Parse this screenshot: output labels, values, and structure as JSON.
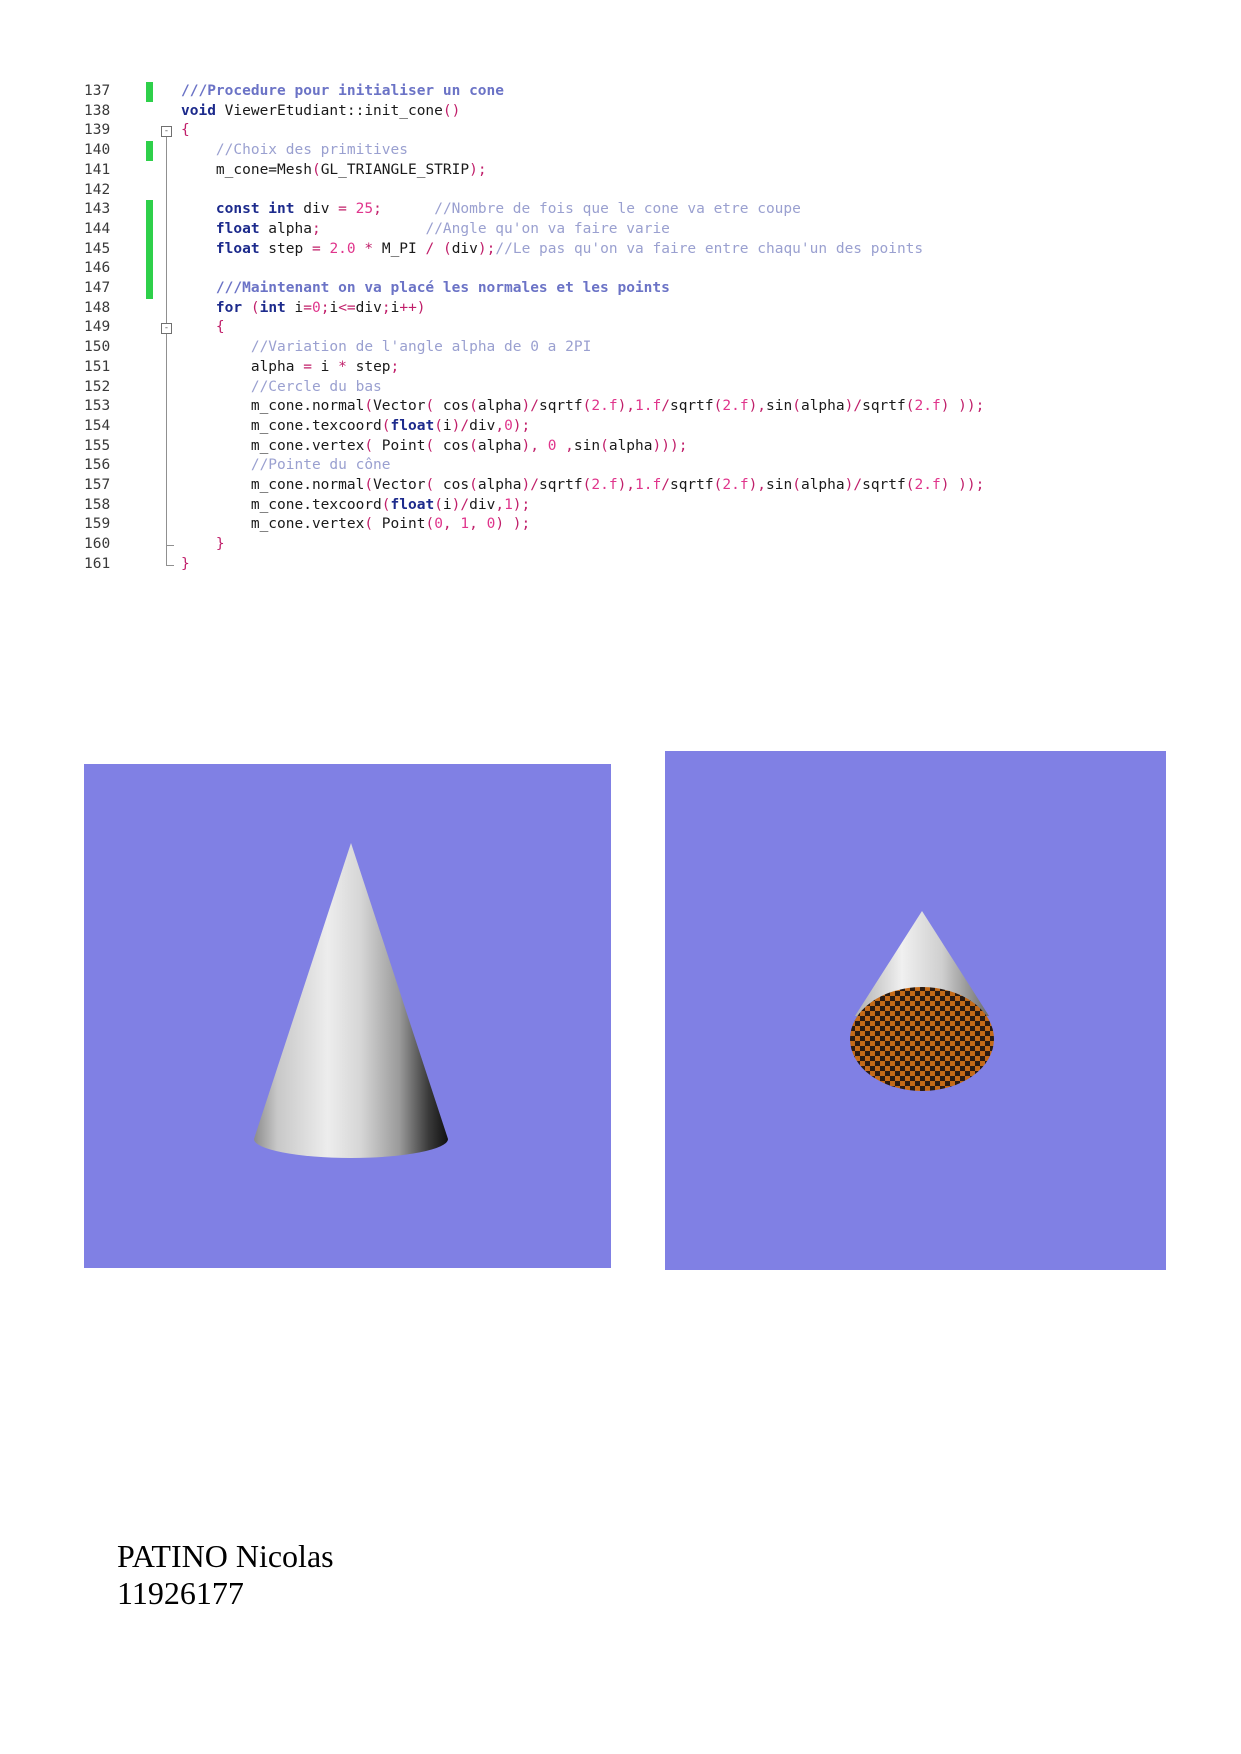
{
  "code": {
    "lines": [
      {
        "n": "137",
        "changed": true,
        "tokens": [
          [
            "dc",
            "///Procedure pour initialiser un cone"
          ]
        ]
      },
      {
        "n": "138",
        "changed": false,
        "tokens": [
          [
            "kw",
            "void"
          ],
          [
            "tx",
            " ViewerEtudiant::init_cone"
          ],
          [
            "op",
            "()"
          ]
        ]
      },
      {
        "n": "139",
        "changed": false,
        "tokens": [
          [
            "op",
            "{"
          ]
        ]
      },
      {
        "n": "140",
        "changed": true,
        "tokens": [
          [
            "tx",
            "    "
          ],
          [
            "cm",
            "//Choix des primitives"
          ]
        ]
      },
      {
        "n": "141",
        "changed": false,
        "tokens": [
          [
            "tx",
            "    m_cone=Mesh"
          ],
          [
            "op",
            "("
          ],
          [
            "tx",
            "GL_TRIANGLE_STRIP"
          ],
          [
            "op",
            ");"
          ]
        ]
      },
      {
        "n": "142",
        "changed": false,
        "tokens": []
      },
      {
        "n": "143",
        "changed": true,
        "tokens": [
          [
            "tx",
            "    "
          ],
          [
            "kw",
            "const int"
          ],
          [
            "tx",
            " div "
          ],
          [
            "op",
            "="
          ],
          [
            "tx",
            " "
          ],
          [
            "nm",
            "25"
          ],
          [
            "op",
            ";"
          ],
          [
            "tx",
            "      "
          ],
          [
            "cm",
            "//Nombre de fois que le cone va etre coupe"
          ]
        ]
      },
      {
        "n": "144",
        "changed": true,
        "tokens": [
          [
            "tx",
            "    "
          ],
          [
            "kw",
            "float"
          ],
          [
            "tx",
            " alpha"
          ],
          [
            "op",
            ";"
          ],
          [
            "tx",
            "            "
          ],
          [
            "cm",
            "//Angle qu'on va faire varie"
          ]
        ]
      },
      {
        "n": "145",
        "changed": true,
        "tokens": [
          [
            "tx",
            "    "
          ],
          [
            "kw",
            "float"
          ],
          [
            "tx",
            " step "
          ],
          [
            "op",
            "="
          ],
          [
            "tx",
            " "
          ],
          [
            "nm",
            "2.0"
          ],
          [
            "tx",
            " "
          ],
          [
            "op",
            "*"
          ],
          [
            "tx",
            " M_PI "
          ],
          [
            "op",
            "/"
          ],
          [
            "tx",
            " "
          ],
          [
            "op",
            "("
          ],
          [
            "tx",
            "div"
          ],
          [
            "op",
            ");"
          ],
          [
            "cm",
            "//Le pas qu'on va faire entre chaqu'un des points"
          ]
        ]
      },
      {
        "n": "146",
        "changed": true,
        "tokens": []
      },
      {
        "n": "147",
        "changed": true,
        "tokens": [
          [
            "tx",
            "    "
          ],
          [
            "dc",
            "///Maintenant on va placé les normales et les points"
          ]
        ]
      },
      {
        "n": "148",
        "changed": false,
        "tokens": [
          [
            "tx",
            "    "
          ],
          [
            "kw",
            "for"
          ],
          [
            "tx",
            " "
          ],
          [
            "op",
            "("
          ],
          [
            "kw",
            "int"
          ],
          [
            "tx",
            " i"
          ],
          [
            "op",
            "="
          ],
          [
            "nm",
            "0"
          ],
          [
            "op",
            ";"
          ],
          [
            "tx",
            "i"
          ],
          [
            "op",
            "<="
          ],
          [
            "tx",
            "div"
          ],
          [
            "op",
            ";"
          ],
          [
            "tx",
            "i"
          ],
          [
            "op",
            "++)"
          ]
        ]
      },
      {
        "n": "149",
        "changed": false,
        "tokens": [
          [
            "tx",
            "    "
          ],
          [
            "op",
            "{"
          ]
        ]
      },
      {
        "n": "150",
        "changed": false,
        "tokens": [
          [
            "tx",
            "        "
          ],
          [
            "cm",
            "//Variation de l'angle alpha de 0 a 2PI"
          ]
        ]
      },
      {
        "n": "151",
        "changed": false,
        "tokens": [
          [
            "tx",
            "        alpha "
          ],
          [
            "op",
            "="
          ],
          [
            "tx",
            " i "
          ],
          [
            "op",
            "*"
          ],
          [
            "tx",
            " step"
          ],
          [
            "op",
            ";"
          ]
        ]
      },
      {
        "n": "152",
        "changed": false,
        "tokens": [
          [
            "tx",
            "        "
          ],
          [
            "cm",
            "//Cercle du bas"
          ]
        ]
      },
      {
        "n": "153",
        "changed": false,
        "tokens": [
          [
            "tx",
            "        m_cone.normal"
          ],
          [
            "op",
            "("
          ],
          [
            "tx",
            "Vector"
          ],
          [
            "op",
            "("
          ],
          [
            "tx",
            " cos"
          ],
          [
            "op",
            "("
          ],
          [
            "tx",
            "alpha"
          ],
          [
            "op",
            ")/"
          ],
          [
            "tx",
            "sqrtf"
          ],
          [
            "op",
            "("
          ],
          [
            "nm",
            "2.f"
          ],
          [
            "op",
            "),"
          ],
          [
            "nm",
            "1.f"
          ],
          [
            "op",
            "/"
          ],
          [
            "tx",
            "sqrtf"
          ],
          [
            "op",
            "("
          ],
          [
            "nm",
            "2.f"
          ],
          [
            "op",
            "),"
          ],
          [
            "tx",
            "sin"
          ],
          [
            "op",
            "("
          ],
          [
            "tx",
            "alpha"
          ],
          [
            "op",
            ")/"
          ],
          [
            "tx",
            "sqrtf"
          ],
          [
            "op",
            "("
          ],
          [
            "nm",
            "2.f"
          ],
          [
            "op",
            ")"
          ],
          [
            "tx",
            " "
          ],
          [
            "op",
            "));"
          ]
        ]
      },
      {
        "n": "154",
        "changed": false,
        "tokens": [
          [
            "tx",
            "        m_cone.texcoord"
          ],
          [
            "op",
            "("
          ],
          [
            "kw",
            "float"
          ],
          [
            "op",
            "("
          ],
          [
            "tx",
            "i"
          ],
          [
            "op",
            ")/"
          ],
          [
            "tx",
            "div"
          ],
          [
            "op",
            ","
          ],
          [
            "nm",
            "0"
          ],
          [
            "op",
            ");"
          ]
        ]
      },
      {
        "n": "155",
        "changed": false,
        "tokens": [
          [
            "tx",
            "        m_cone.vertex"
          ],
          [
            "op",
            "("
          ],
          [
            "tx",
            " Point"
          ],
          [
            "op",
            "("
          ],
          [
            "tx",
            " cos"
          ],
          [
            "op",
            "("
          ],
          [
            "tx",
            "alpha"
          ],
          [
            "op",
            "),"
          ],
          [
            "tx",
            " "
          ],
          [
            "nm",
            "0"
          ],
          [
            "tx",
            " "
          ],
          [
            "op",
            ","
          ],
          [
            "tx",
            "sin"
          ],
          [
            "op",
            "("
          ],
          [
            "tx",
            "alpha"
          ],
          [
            "op",
            ")));"
          ]
        ]
      },
      {
        "n": "156",
        "changed": false,
        "tokens": [
          [
            "tx",
            "        "
          ],
          [
            "cm",
            "//Pointe du cône"
          ]
        ]
      },
      {
        "n": "157",
        "changed": false,
        "tokens": [
          [
            "tx",
            "        m_cone.normal"
          ],
          [
            "op",
            "("
          ],
          [
            "tx",
            "Vector"
          ],
          [
            "op",
            "("
          ],
          [
            "tx",
            " cos"
          ],
          [
            "op",
            "("
          ],
          [
            "tx",
            "alpha"
          ],
          [
            "op",
            ")/"
          ],
          [
            "tx",
            "sqrtf"
          ],
          [
            "op",
            "("
          ],
          [
            "nm",
            "2.f"
          ],
          [
            "op",
            "),"
          ],
          [
            "nm",
            "1.f"
          ],
          [
            "op",
            "/"
          ],
          [
            "tx",
            "sqrtf"
          ],
          [
            "op",
            "("
          ],
          [
            "nm",
            "2.f"
          ],
          [
            "op",
            "),"
          ],
          [
            "tx",
            "sin"
          ],
          [
            "op",
            "("
          ],
          [
            "tx",
            "alpha"
          ],
          [
            "op",
            ")/"
          ],
          [
            "tx",
            "sqrtf"
          ],
          [
            "op",
            "("
          ],
          [
            "nm",
            "2.f"
          ],
          [
            "op",
            ")"
          ],
          [
            "tx",
            " "
          ],
          [
            "op",
            "));"
          ]
        ]
      },
      {
        "n": "158",
        "changed": false,
        "tokens": [
          [
            "tx",
            "        m_cone.texcoord"
          ],
          [
            "op",
            "("
          ],
          [
            "kw",
            "float"
          ],
          [
            "op",
            "("
          ],
          [
            "tx",
            "i"
          ],
          [
            "op",
            ")/"
          ],
          [
            "tx",
            "div"
          ],
          [
            "op",
            ","
          ],
          [
            "nm",
            "1"
          ],
          [
            "op",
            ");"
          ]
        ]
      },
      {
        "n": "159",
        "changed": false,
        "tokens": [
          [
            "tx",
            "        m_cone.vertex"
          ],
          [
            "op",
            "("
          ],
          [
            "tx",
            " Point"
          ],
          [
            "op",
            "("
          ],
          [
            "nm",
            "0"
          ],
          [
            "op",
            ","
          ],
          [
            "tx",
            " "
          ],
          [
            "nm",
            "1"
          ],
          [
            "op",
            ","
          ],
          [
            "tx",
            " "
          ],
          [
            "nm",
            "0"
          ],
          [
            "op",
            ")"
          ],
          [
            "tx",
            " "
          ],
          [
            "op",
            ");"
          ]
        ]
      },
      {
        "n": "160",
        "changed": false,
        "tokens": [
          [
            "tx",
            "    "
          ],
          [
            "op",
            "}"
          ]
        ]
      },
      {
        "n": "161",
        "changed": false,
        "tokens": [
          [
            "op",
            "}"
          ]
        ]
      }
    ],
    "colors": {
      "changed_marker": "#2ed04a",
      "keyword": "#1c2a8c",
      "comment": "#9aa0d0",
      "number": "#e0358c"
    }
  },
  "renders": {
    "background_color": "#8080e4",
    "left": {
      "subject": "shaded-cone-side-view"
    },
    "right": {
      "subject": "cone-with-checkerboard-base",
      "base_colors": [
        "#c46a18",
        "#2a1a10"
      ]
    }
  },
  "author": {
    "name": "PATINO Nicolas",
    "student_id": "11926177"
  }
}
